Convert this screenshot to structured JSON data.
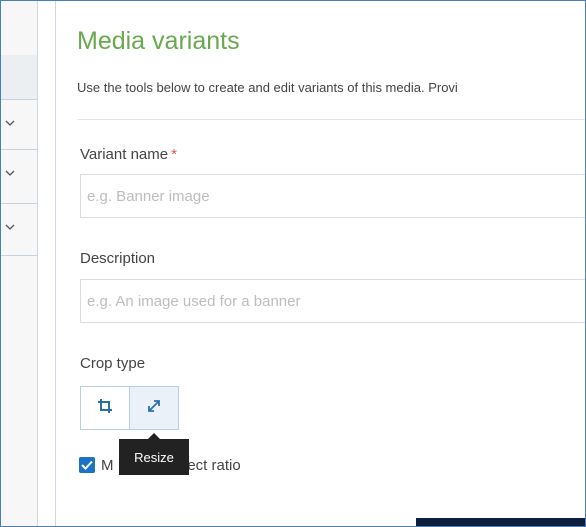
{
  "panel": {
    "title": "Media variants",
    "subtitle": "Use the tools below to create and edit variants of this media. Provi"
  },
  "form": {
    "variant_name": {
      "label": "Variant name",
      "required_marker": "*",
      "placeholder": "e.g. Banner image",
      "value": ""
    },
    "description": {
      "label": "Description",
      "placeholder": "e.g. An image used for a banner",
      "value": ""
    },
    "crop_type": {
      "label": "Crop type",
      "options": [
        {
          "icon": "crop-icon"
        },
        {
          "icon": "resize-icon",
          "active": true
        }
      ],
      "tooltip": "Resize"
    },
    "aspect": {
      "label_start": "M",
      "label_end": "spect ratio",
      "checked": true
    }
  },
  "colors": {
    "title_green": "#6aa84f",
    "accent_blue": "#1a73c7",
    "required_red": "#d9534f",
    "tooltip_bg": "#222222"
  }
}
